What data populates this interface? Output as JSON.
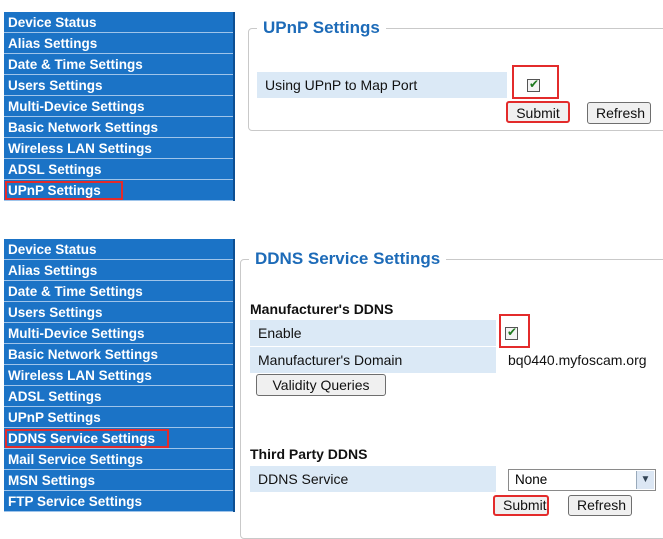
{
  "top": {
    "menu": [
      "Device Status",
      "Alias Settings",
      "Date & Time Settings",
      "Users Settings",
      "Multi-Device Settings",
      "Basic Network Settings",
      "Wireless LAN Settings",
      "ADSL Settings",
      "UPnP Settings"
    ],
    "section_title": "UPnP Settings",
    "upnp_label": "Using UPnP to Map Port",
    "upnp_checked": true,
    "submit_label": "Submit",
    "refresh_label": "Refresh"
  },
  "bottom": {
    "menu": [
      "Device Status",
      "Alias Settings",
      "Date & Time Settings",
      "Users Settings",
      "Multi-Device Settings",
      "Basic Network Settings",
      "Wireless LAN Settings",
      "ADSL Settings",
      "UPnP Settings",
      "DDNS Service Settings",
      "Mail Service Settings",
      "MSN Settings",
      "FTP Service Settings"
    ],
    "section_title": "DDNS Service Settings",
    "manufacturer_heading": "Manufacturer's DDNS",
    "enable_label": "Enable",
    "enable_checked": true,
    "domain_label": "Manufacturer's Domain",
    "domain_value": "bq0440.myfoscam.org",
    "validity_label": "Validity Queries",
    "third_party_heading": "Third Party DDNS",
    "ddns_service_label": "DDNS Service",
    "ddns_service_value": "None",
    "submit_label": "Submit",
    "refresh_label": "Refresh"
  }
}
